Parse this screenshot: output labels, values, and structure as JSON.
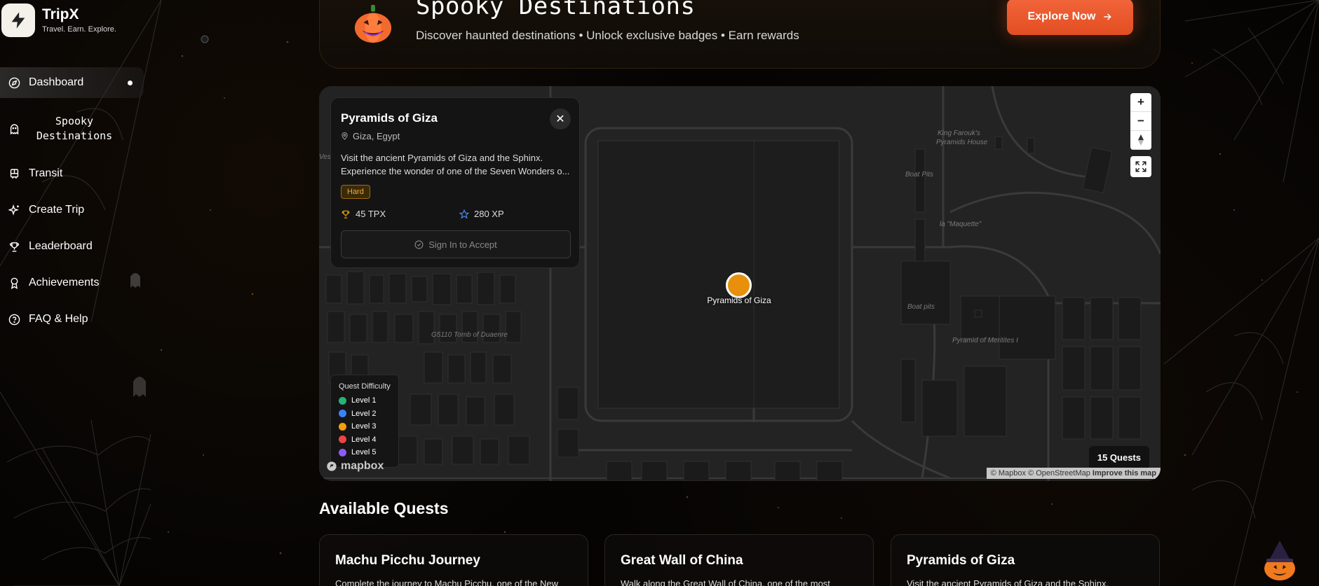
{
  "app": {
    "name": "TripX",
    "tagline": "Travel. Earn. Explore."
  },
  "sidebar": {
    "items": [
      {
        "label": "Dashboard",
        "icon": "compass-icon",
        "active": true
      },
      {
        "label": "Spooky Destinations",
        "icon": "ghost-icon"
      },
      {
        "label": "Transit",
        "icon": "train-icon"
      },
      {
        "label": "Create Trip",
        "icon": "sparkles-icon"
      },
      {
        "label": "Leaderboard",
        "icon": "trophy-icon"
      },
      {
        "label": "Achievements",
        "icon": "award-icon"
      },
      {
        "label": "FAQ & Help",
        "icon": "help-circle-icon"
      }
    ]
  },
  "banner": {
    "title": "Spooky Destinations",
    "subtitle": "Discover haunted destinations • Unlock exclusive badges • Earn rewards",
    "cta": "Explore Now"
  },
  "map": {
    "popup": {
      "title": "Pyramids of Giza",
      "location": "Giza, Egypt",
      "description": "Visit the ancient Pyramids of Giza and the Sphinx. Experience the wonder of one of the Seven Wonders o...",
      "difficulty": "Hard",
      "tpx": "45 TPX",
      "xp": "280 XP",
      "action": "Sign In to Accept"
    },
    "marker_label": "Pyramids of Giza",
    "place_labels": {
      "king_farouk": "King Farouk's",
      "king_farouk2": "Pyramids House",
      "boat_pits_1": "Boat Pits",
      "maquette": "la \"Maquette\"",
      "boat_pits_2": "Boat pits",
      "meritites": "Pyramid of Meritites I",
      "tomb": "G5110 Tomb of Duaenre",
      "west_partial": "Ves"
    },
    "legend": {
      "title": "Quest Difficulty",
      "levels": [
        {
          "label": "Level 1",
          "color": "#22b573"
        },
        {
          "label": "Level 2",
          "color": "#3b82f6"
        },
        {
          "label": "Level 3",
          "color": "#f59e0b"
        },
        {
          "label": "Level 4",
          "color": "#ef4444"
        },
        {
          "label": "Level 5",
          "color": "#8b5cf6"
        }
      ]
    },
    "quest_count": "15 Quests",
    "attribution": {
      "mapbox": "© Mapbox",
      "osm": "© OpenStreetMap",
      "improve": "Improve this map"
    },
    "logo": "mapbox",
    "marker_color": "#e8900c"
  },
  "quests": {
    "section_title": "Available Quests",
    "cards": [
      {
        "title": "Machu Picchu Journey",
        "description": "Complete the journey to Machu Picchu, one of the New"
      },
      {
        "title": "Great Wall of China",
        "description": "Walk along the Great Wall of China, one of the most"
      },
      {
        "title": "Pyramids of Giza",
        "description": "Visit the ancient Pyramids of Giza and the Sphinx."
      }
    ]
  },
  "colors": {
    "accent": "#e8552a",
    "background": "#050403"
  }
}
